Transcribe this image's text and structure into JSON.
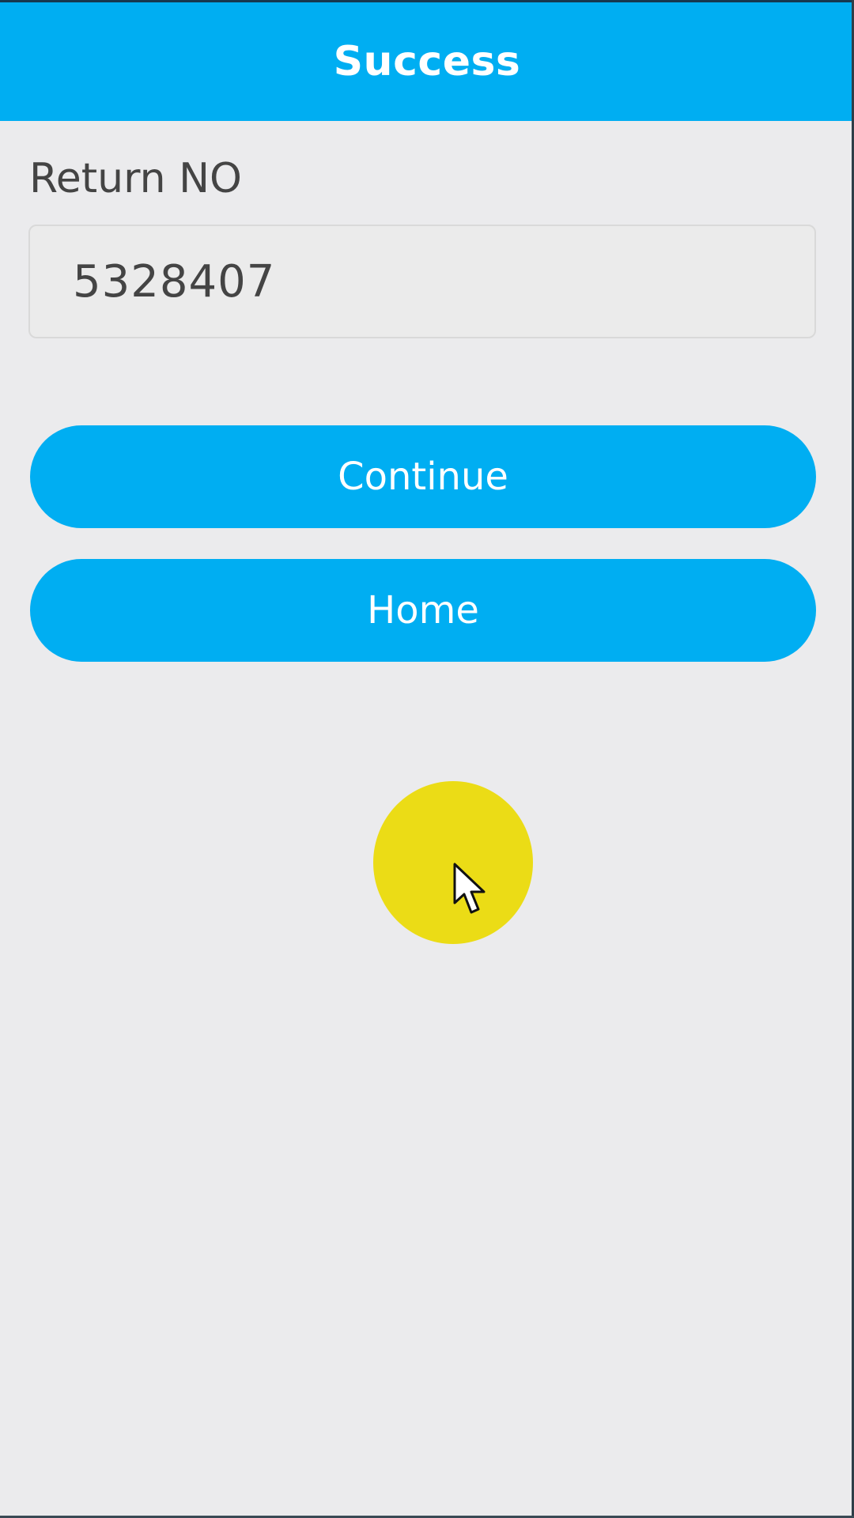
{
  "header": {
    "title": "Success"
  },
  "form": {
    "return_no_label": "Return NO",
    "return_no_value": "5328407"
  },
  "actions": {
    "continue_label": "Continue",
    "home_label": "Home"
  },
  "overlay": {
    "cursor_icon": "arrow-cursor-icon",
    "click_indicator_color": "#ebdc16"
  },
  "colors": {
    "accent": "#00aef2",
    "background": "#ebebed",
    "text": "#444444"
  }
}
